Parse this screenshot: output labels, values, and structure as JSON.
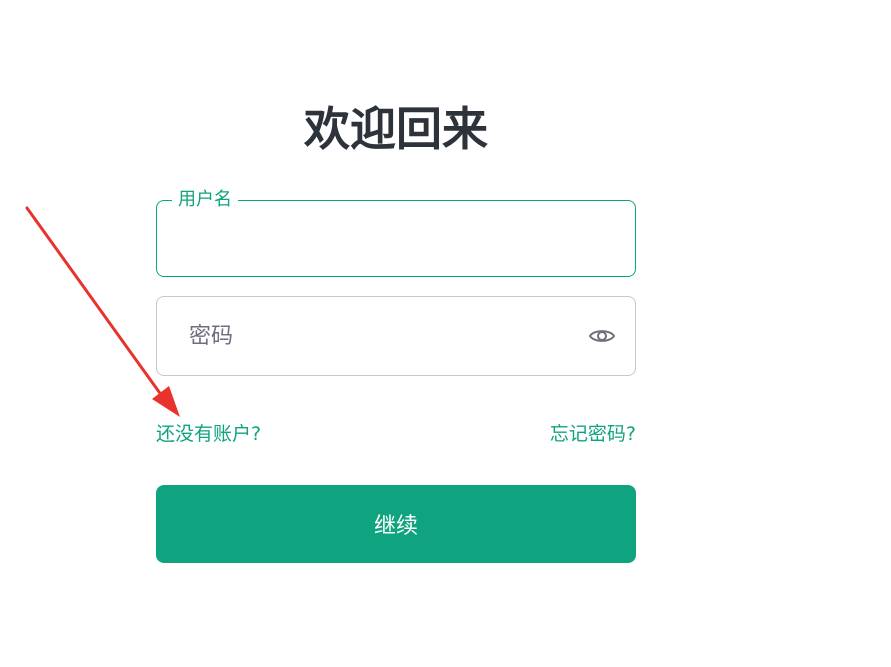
{
  "page": {
    "title": "欢迎回来"
  },
  "username": {
    "label": "用户名",
    "value": ""
  },
  "password": {
    "placeholder": "密码",
    "value": "",
    "toggle_icon": "eye-icon"
  },
  "links": {
    "signup": "还没有账户?",
    "forgot": "忘记密码?"
  },
  "actions": {
    "continue_label": "继续"
  },
  "colors": {
    "accent": "#10a37f",
    "title": "#2d333a",
    "border_inactive": "#c2c8d0",
    "annotation_arrow": "#e8322b"
  }
}
